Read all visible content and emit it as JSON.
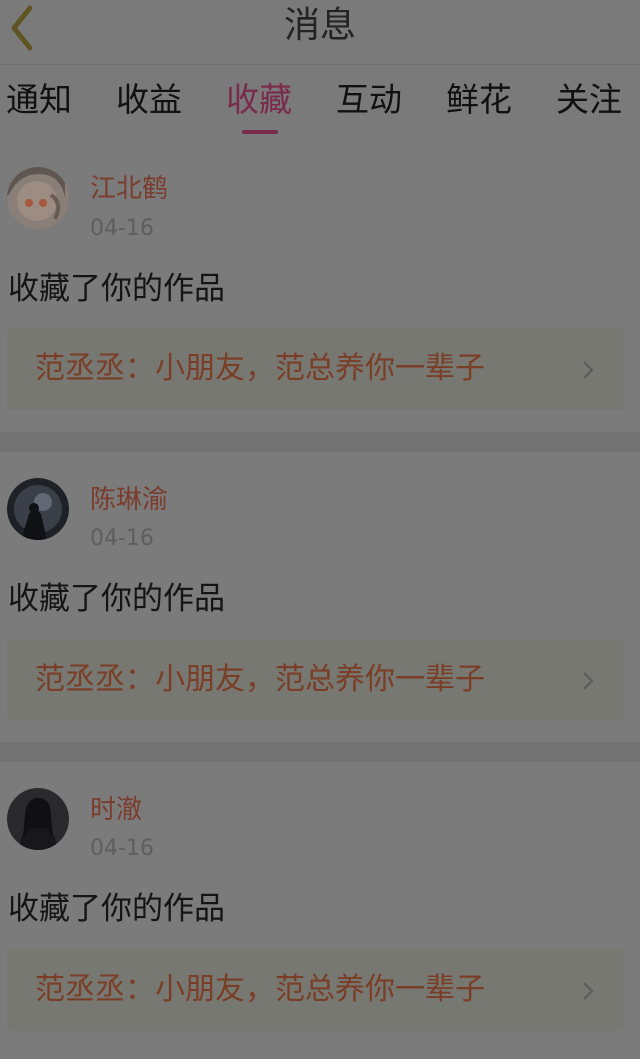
{
  "header": {
    "title": "消息",
    "back_icon": "chevron-left-icon"
  },
  "tabs": [
    {
      "label": "通知",
      "active": false
    },
    {
      "label": "收益",
      "active": false
    },
    {
      "label": "收藏",
      "active": true
    },
    {
      "label": "互动",
      "active": false
    },
    {
      "label": "鲜花",
      "active": false
    },
    {
      "label": "关注",
      "active": false
    }
  ],
  "colors": {
    "accent": "#7a2a4a",
    "name": "#7a3c2c",
    "work_title": "#7a3d25",
    "back": "#5f5422"
  },
  "items": [
    {
      "user": "江北鹤",
      "date": "04-16",
      "action": "收藏了你的作品",
      "work_title": "范丞丞：小朋友，范总养你一辈子"
    },
    {
      "user": "陈琳渝",
      "date": "04-16",
      "action": "收藏了你的作品",
      "work_title": "范丞丞：小朋友，范总养你一辈子"
    },
    {
      "user": "时澈",
      "date": "04-16",
      "action": "收藏了你的作品",
      "work_title": "范丞丞：小朋友，范总养你一辈子"
    }
  ]
}
